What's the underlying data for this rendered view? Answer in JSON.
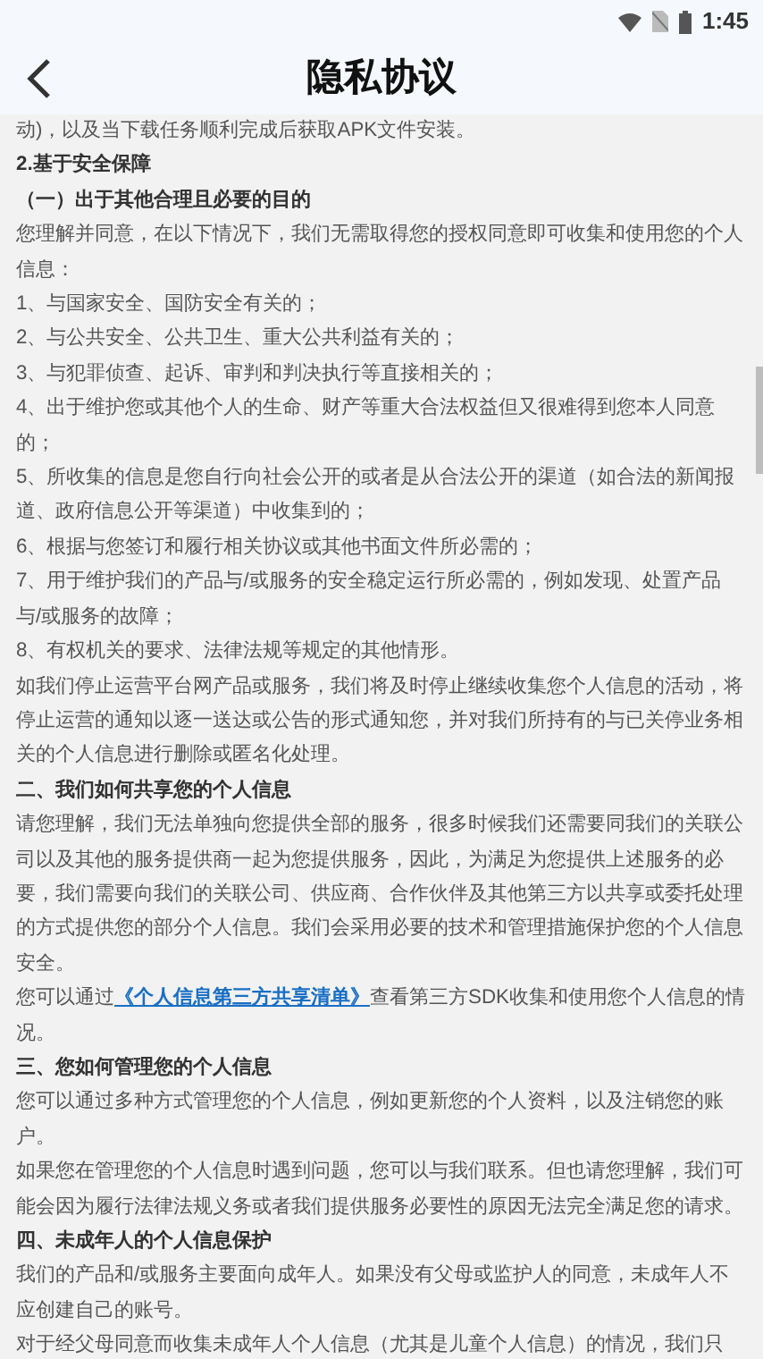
{
  "status_bar": {
    "time": "1:45"
  },
  "header": {
    "title": "隐私协议"
  },
  "content": [
    {
      "kind": "text",
      "text": "动)，以及当下载任务顺利完成后获取APK文件安装。"
    },
    {
      "kind": "heading",
      "text": "2.基于安全保障"
    },
    {
      "kind": "heading",
      "text": "（一）出于其他合理且必要的目的"
    },
    {
      "kind": "text",
      "text": "您理解并同意，在以下情况下，我们无需取得您的授权同意即可收集和使用您的个人信息："
    },
    {
      "kind": "text",
      "text": "1、与国家安全、国防安全有关的；"
    },
    {
      "kind": "text",
      "text": "2、与公共安全、公共卫生、重大公共利益有关的；"
    },
    {
      "kind": "text",
      "text": "3、与犯罪侦查、起诉、审判和判决执行等直接相关的；"
    },
    {
      "kind": "text",
      "text": "4、出于维护您或其他个人的生命、财产等重大合法权益但又很难得到您本人同意的；"
    },
    {
      "kind": "text",
      "text": "5、所收集的信息是您自行向社会公开的或者是从合法公开的渠道（如合法的新闻报道、政府信息公开等渠道）中收集到的；"
    },
    {
      "kind": "text",
      "text": "6、根据与您签订和履行相关协议或其他书面文件所必需的；"
    },
    {
      "kind": "text",
      "text": "7、用于维护我们的产品与/或服务的安全稳定运行所必需的，例如发现、处置产品与/或服务的故障；"
    },
    {
      "kind": "text",
      "text": "8、有权机关的要求、法律法规等规定的其他情形。"
    },
    {
      "kind": "text",
      "text": "如我们停止运营平台网产品或服务，我们将及时停止继续收集您个人信息的活动，将停止运营的通知以逐一送达或公告的形式通知您，并对我们所持有的与已关停业务相关的个人信息进行删除或匿名化处理。"
    },
    {
      "kind": "heading",
      "text": "二、我们如何共享您的个人信息"
    },
    {
      "kind": "text",
      "text": "请您理解，我们无法单独向您提供全部的服务，很多时候我们还需要同我们的关联公司以及其他的服务提供商一起为您提供服务，因此，为满足为您提供上述服务的必要，我们需要向我们的关联公司、供应商、合作伙伴及其他第三方以共享或委托处理的方式提供您的部分个人信息。我们会采用必要的技术和管理措施保护您的个人信息安全。"
    },
    {
      "kind": "link_text",
      "before": "您可以通过",
      "link": "《个人信息第三方共享清单》",
      "after": "查看第三方SDK收集和使用您个人信息的情况。"
    },
    {
      "kind": "heading",
      "text": "三、您如何管理您的个人信息"
    },
    {
      "kind": "text",
      "text": "您可以通过多种方式管理您的个人信息，例如更新您的个人资料，以及注销您的账户。"
    },
    {
      "kind": "text",
      "text": "如果您在管理您的个人信息时遇到问题，您可以与我们联系。但也请您理解，我们可能会因为履行法律法规义务或者我们提供服务必要性的原因无法完全满足您的请求。"
    },
    {
      "kind": "heading",
      "text": "四、未成年人的个人信息保护"
    },
    {
      "kind": "text",
      "text": "我们的产品和/或服务主要面向成年人。如果没有父母或监护人的同意，未成年人不应创建自己的账号。"
    },
    {
      "kind": "text",
      "text": "对于经父母同意而收集未成年人个人信息（尤其是儿童个人信息）的情况，我们只"
    }
  ]
}
